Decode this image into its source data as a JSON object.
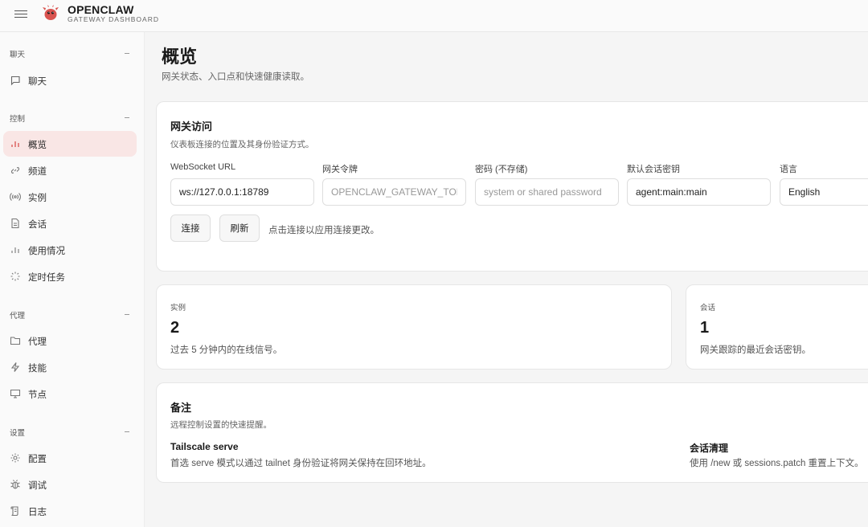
{
  "header": {
    "brand": "OPENCLAW",
    "brand_sub": "GATEWAY DASHBOARD"
  },
  "sidebar": {
    "sections": [
      {
        "label": "聊天",
        "items": [
          {
            "label": "聊天",
            "icon": "chat-icon"
          }
        ]
      },
      {
        "label": "控制",
        "items": [
          {
            "label": "概览",
            "icon": "bar-chart-icon",
            "active": true
          },
          {
            "label": "频道",
            "icon": "link-icon"
          },
          {
            "label": "实例",
            "icon": "broadcast-icon"
          },
          {
            "label": "会话",
            "icon": "document-icon"
          },
          {
            "label": "使用情况",
            "icon": "bar-chart-icon"
          },
          {
            "label": "定时任务",
            "icon": "loader-icon"
          }
        ]
      },
      {
        "label": "代理",
        "items": [
          {
            "label": "代理",
            "icon": "folder-icon"
          },
          {
            "label": "技能",
            "icon": "lightning-icon"
          },
          {
            "label": "节点",
            "icon": "monitor-icon"
          }
        ]
      },
      {
        "label": "设置",
        "items": [
          {
            "label": "配置",
            "icon": "gear-icon"
          },
          {
            "label": "调试",
            "icon": "bug-icon"
          },
          {
            "label": "日志",
            "icon": "scroll-icon"
          }
        ]
      }
    ]
  },
  "page": {
    "title": "概览",
    "subtitle": "网关状态、入口点和快速健康读取。"
  },
  "access": {
    "title": "网关访问",
    "subtitle": "仪表板连接的位置及其身份验证方式。",
    "fields": [
      {
        "label": "WebSocket URL",
        "value": "ws://127.0.0.1:18789",
        "placeholder": ""
      },
      {
        "label": "网关令牌",
        "value": "",
        "placeholder": "OPENCLAW_GATEWAY_TOKEN"
      },
      {
        "label": "密码 (不存储)",
        "value": "",
        "placeholder": "system or shared password"
      },
      {
        "label": "默认会话密钥",
        "value": "agent:main:main",
        "placeholder": ""
      },
      {
        "label": "语言",
        "value": "English",
        "placeholder": ""
      }
    ],
    "connect_label": "连接",
    "refresh_label": "刷新",
    "hint": "点击连接以应用连接更改。"
  },
  "stats": [
    {
      "label": "实例",
      "value": "2",
      "desc": "过去 5 分钟内的在线信号。"
    },
    {
      "label": "会话",
      "value": "1",
      "desc": "网关跟踪的最近会话密钥。"
    }
  ],
  "notes": {
    "title": "备注",
    "subtitle": "远程控制设置的快速提醒。",
    "items": [
      {
        "title": "Tailscale serve",
        "desc": "首选 serve 模式以通过 tailnet 身份验证将网关保持在回环地址。"
      },
      {
        "title": "会话清理",
        "desc": "使用 /new 或 sessions.patch 重置上下文。"
      }
    ]
  },
  "colors": {
    "accent": "#d9534f",
    "active_bg": "#f9e6e5"
  }
}
